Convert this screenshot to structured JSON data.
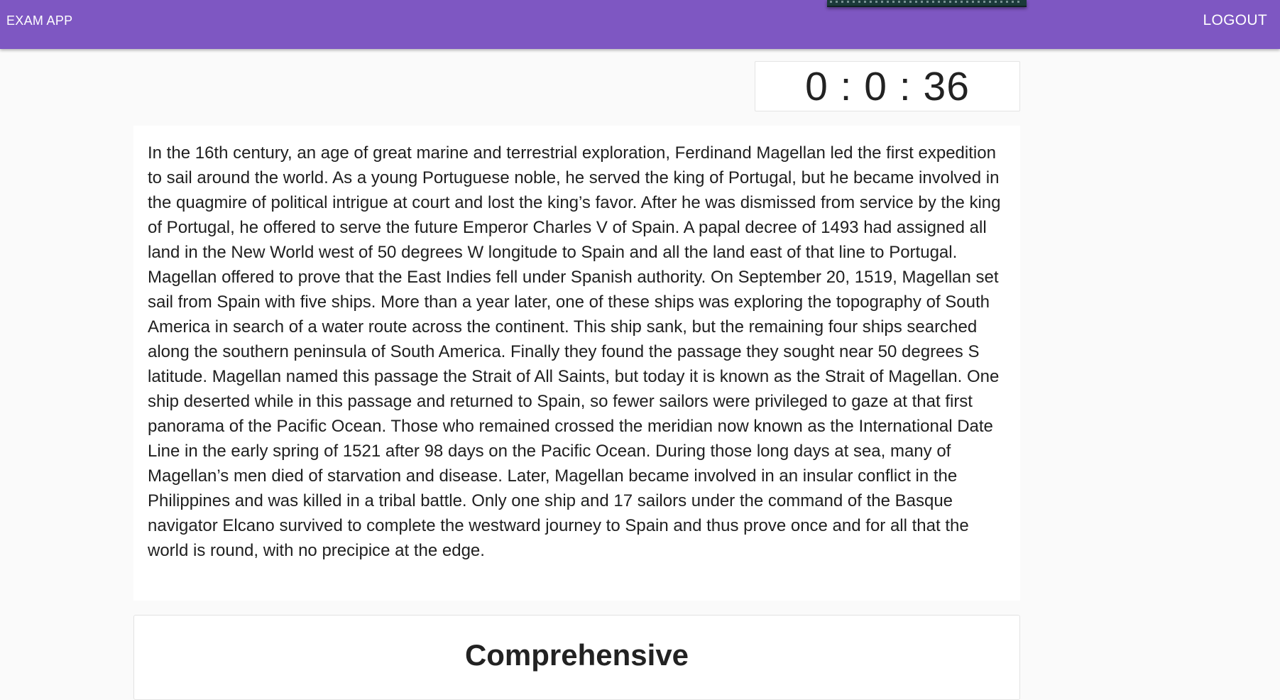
{
  "appbar": {
    "brand": "EXAM APP",
    "logout_label": "LOGOUT",
    "color": "#7e57c2"
  },
  "timer": {
    "display": "0 : 0 : 36"
  },
  "passage": {
    "text": "In the 16th century, an age of great marine and terrestrial exploration, Ferdinand Magellan led the first expedition to sail around the world. As a young Portuguese noble, he served the king of Portugal, but he became involved in the quagmire of political intrigue at court and lost the king’s favor. After he was dismissed from service by the king of Portugal, he offered to serve the future Emperor Charles V of Spain. A papal decree of 1493 had assigned all land in the New World west of 50 degrees W longitude to Spain and all the land east of that line to Portugal. Magellan offered to prove that the East Indies fell under Spanish authority. On September 20, 1519, Magellan set sail from Spain with five ships. More than a year later, one of these ships was exploring the topography of South America in search of a water route across the continent. This ship sank, but the remaining four ships searched along the southern peninsula of South America. Finally they found the passage they sought near 50 degrees S latitude. Magellan named this passage the Strait of All Saints, but today it is known as the Strait of Magellan. One ship deserted while in this passage and returned to Spain, so fewer sailors were privileged to gaze at that first panorama of the Pacific Ocean. Those who remained crossed the meridian now known as the International Date Line in the early spring of 1521 after 98 days on the Pacific Ocean. During those long days at sea, many of Magellan’s men died of starvation and disease. Later, Magellan became involved in an insular conflict in the Philippines and was killed in a tribal battle. Only one ship and 17 sailors under the command of the Basque navigator Elcano survived to complete the westward journey to Spain and thus prove once and for all that the world is round, with no precipice at the edge."
  },
  "question_section": {
    "title": "Comprehensive"
  }
}
